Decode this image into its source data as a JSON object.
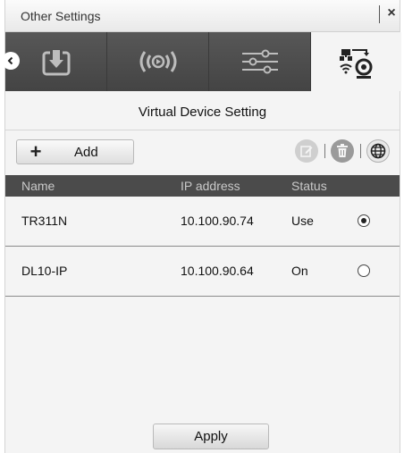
{
  "window": {
    "title": "Other Settings",
    "close_symbol": "×"
  },
  "tabs": [
    {
      "icon": "download-icon",
      "active": false
    },
    {
      "icon": "broadcast-icon",
      "active": false
    },
    {
      "icon": "sliders-icon",
      "active": false
    },
    {
      "icon": "network-camera-icon",
      "active": true
    }
  ],
  "section": {
    "title": "Virtual Device Setting"
  },
  "toolbar": {
    "add_symbol": "+",
    "add_label": "Add",
    "icons": [
      "edit-icon",
      "delete-icon",
      "globe-icon"
    ]
  },
  "table": {
    "columns": [
      "Name",
      "IP address",
      "Status"
    ],
    "rows": [
      {
        "name": "TR311N",
        "ip": "10.100.90.74",
        "status": "Use",
        "selected": true
      },
      {
        "name": "DL10-IP",
        "ip": "10.100.90.64",
        "status": "On",
        "selected": false
      }
    ]
  },
  "footer": {
    "apply_label": "Apply"
  },
  "colors": {
    "header_dark": "#4b4b4b",
    "tab_active": "#f4f4f4",
    "panel_bg": "#f4f4f4"
  }
}
